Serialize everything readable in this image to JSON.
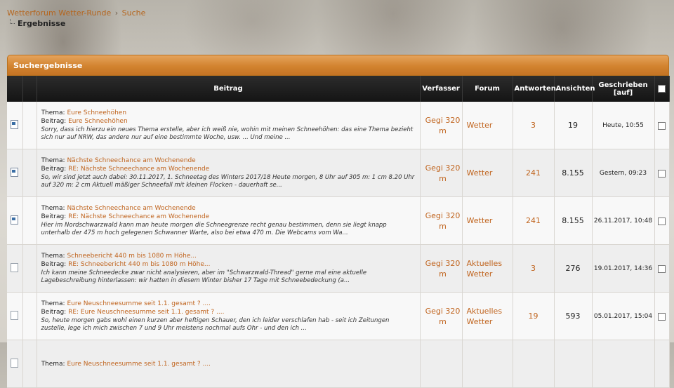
{
  "breadcrumb": {
    "forum": "Wetterforum Wetter-Runde",
    "separator": "›",
    "section": "Suche",
    "current": "Ergebnisse"
  },
  "panel": {
    "title": "Suchergebnisse"
  },
  "columns": {
    "beitrag": "Beitrag",
    "verfasser": "Verfasser",
    "forum": "Forum",
    "antworten": "Antworten",
    "ansichten": "Ansichten",
    "geschrieben": "Geschrieben [auf]"
  },
  "labels": {
    "thema": "Thema:",
    "beitrag": "Beitrag:"
  },
  "rows": [
    {
      "icon": "topic-new-icon",
      "thema": "Eure Schneehöhen",
      "beitrag": "Eure Schneehöhen",
      "excerpt": "Sorry, dass ich hierzu ein neues Thema erstelle, aber ich weiß nie, wohin mit meinen Schneehöhen: das eine Thema bezieht sich nur auf NRW, das andere nur auf eine bestimmte Woche, usw. ... Und meine ...",
      "author": "Gegi 320 m",
      "forum": "Wetter",
      "replies": "3",
      "views": "19",
      "date": "Heute, 10:55"
    },
    {
      "icon": "topic-new-icon",
      "thema": "Nächste Schneechance am Wochenende",
      "beitrag": "RE: Nächste Schneechance am Wochenende",
      "excerpt": "So, wir sind jetzt auch dabei: 30.11.2017, 1. Schneetag des Winters 2017/18 Heute morgen, 8 Uhr auf 305 m: 1 cm 8.20 Uhr auf 320 m: 2 cm Aktuell mäßiger Schneefall mit kleinen Flocken - dauerhaft se...",
      "author": "Gegi 320 m",
      "forum": "Wetter",
      "replies": "241",
      "views": "8.155",
      "date": "Gestern, 09:23"
    },
    {
      "icon": "topic-new-icon",
      "thema": "Nächste Schneechance am Wochenende",
      "beitrag": "RE: Nächste Schneechance am Wochenende",
      "excerpt": "Hier im Nordschwarzwald kann man heute morgen die Schneegrenze recht genau bestimmen, denn sie liegt knapp unterhalb der 475 m hoch gelegenen Schwanner Warte, also bei etwa 470 m.  Die Webcams vom Wa...",
      "author": "Gegi 320 m",
      "forum": "Wetter",
      "replies": "241",
      "views": "8.155",
      "date": "26.11.2017, 10:48"
    },
    {
      "icon": "topic-old-icon",
      "thema": "Schneebericht 440 m bis 1080 m Höhe...",
      "beitrag": "RE: Schneebericht 440 m bis 1080 m Höhe...",
      "excerpt": "Ich kann meine Schneedecke zwar nicht analysieren, aber im \"Schwarzwald-Thread\" gerne mal eine aktuelle Lagebeschreibung hinterlassen: wir hatten in diesem Winter bisher 17 Tage mit Schneebedeckung (a...",
      "author": "Gegi 320 m",
      "forum": "Aktuelles Wetter",
      "replies": "3",
      "views": "276",
      "date": "19.01.2017, 14:36"
    },
    {
      "icon": "topic-old-icon",
      "thema": "Eure Neuschneesumme seit 1.1. gesamt ? ....",
      "beitrag": "RE: Eure Neuschneesumme seit 1.1. gesamt ? ....",
      "excerpt": "So, heute morgen gabs wohl einen kurzen aber heftigen Schauer, den ich leider verschlafen hab - seit ich Zeitungen zustelle, lege ich mich zwischen 7 und 9 Uhr meistens nochmal aufs Ohr - und den ich ...",
      "author": "Gegi 320 m",
      "forum": "Aktuelles Wetter",
      "replies": "19",
      "views": "593",
      "date": "05.01.2017, 15:04"
    },
    {
      "icon": "topic-old-icon",
      "thema": "Eure Neuschneesumme seit 1.1. gesamt ? ....",
      "beitrag": "",
      "excerpt": "",
      "author": "",
      "forum": "",
      "replies": "",
      "views": "",
      "date": ""
    }
  ]
}
